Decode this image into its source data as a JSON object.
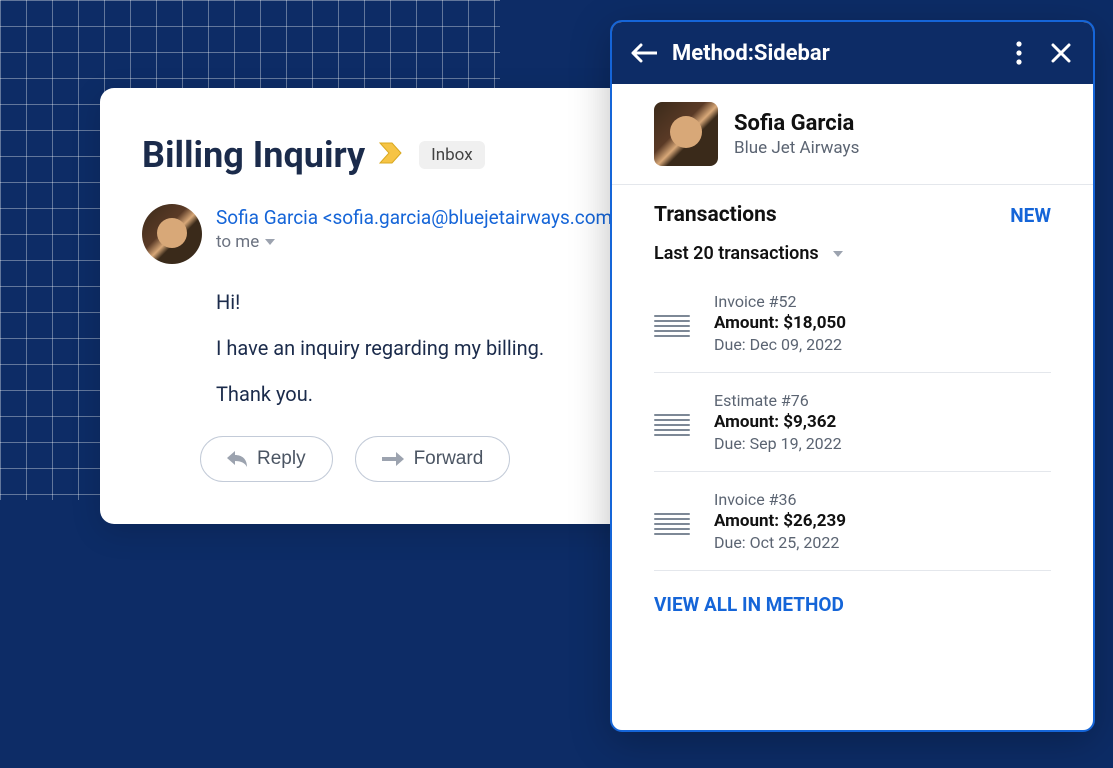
{
  "email": {
    "subject": "Billing Inquiry",
    "tag": "Inbox",
    "sender_display": "Sofia Garcia <sofia.garcia@bluejetairways.com>",
    "to_line": "to me",
    "body_line1": "Hi!",
    "body_line2": "I have an inquiry regarding my billing.",
    "body_line3": "Thank you.",
    "reply_label": "Reply",
    "forward_label": "Forward"
  },
  "sidebar": {
    "title": "Method:Sidebar",
    "contact": {
      "name": "Sofia Garcia",
      "company": "Blue Jet Airways"
    },
    "transactions_heading": "Transactions",
    "new_label": "NEW",
    "filter_label": "Last 20 transactions",
    "view_all_label": "VIEW ALL IN METHOD",
    "transactions": [
      {
        "ref": "Invoice #52",
        "amount": "Amount: $18,050",
        "due": "Due: Dec 09, 2022"
      },
      {
        "ref": "Estimate #76",
        "amount": "Amount: $9,362",
        "due": "Due: Sep 19, 2022"
      },
      {
        "ref": "Invoice #36",
        "amount": "Amount: $26,239",
        "due": "Due: Oct 25, 2022"
      }
    ]
  }
}
